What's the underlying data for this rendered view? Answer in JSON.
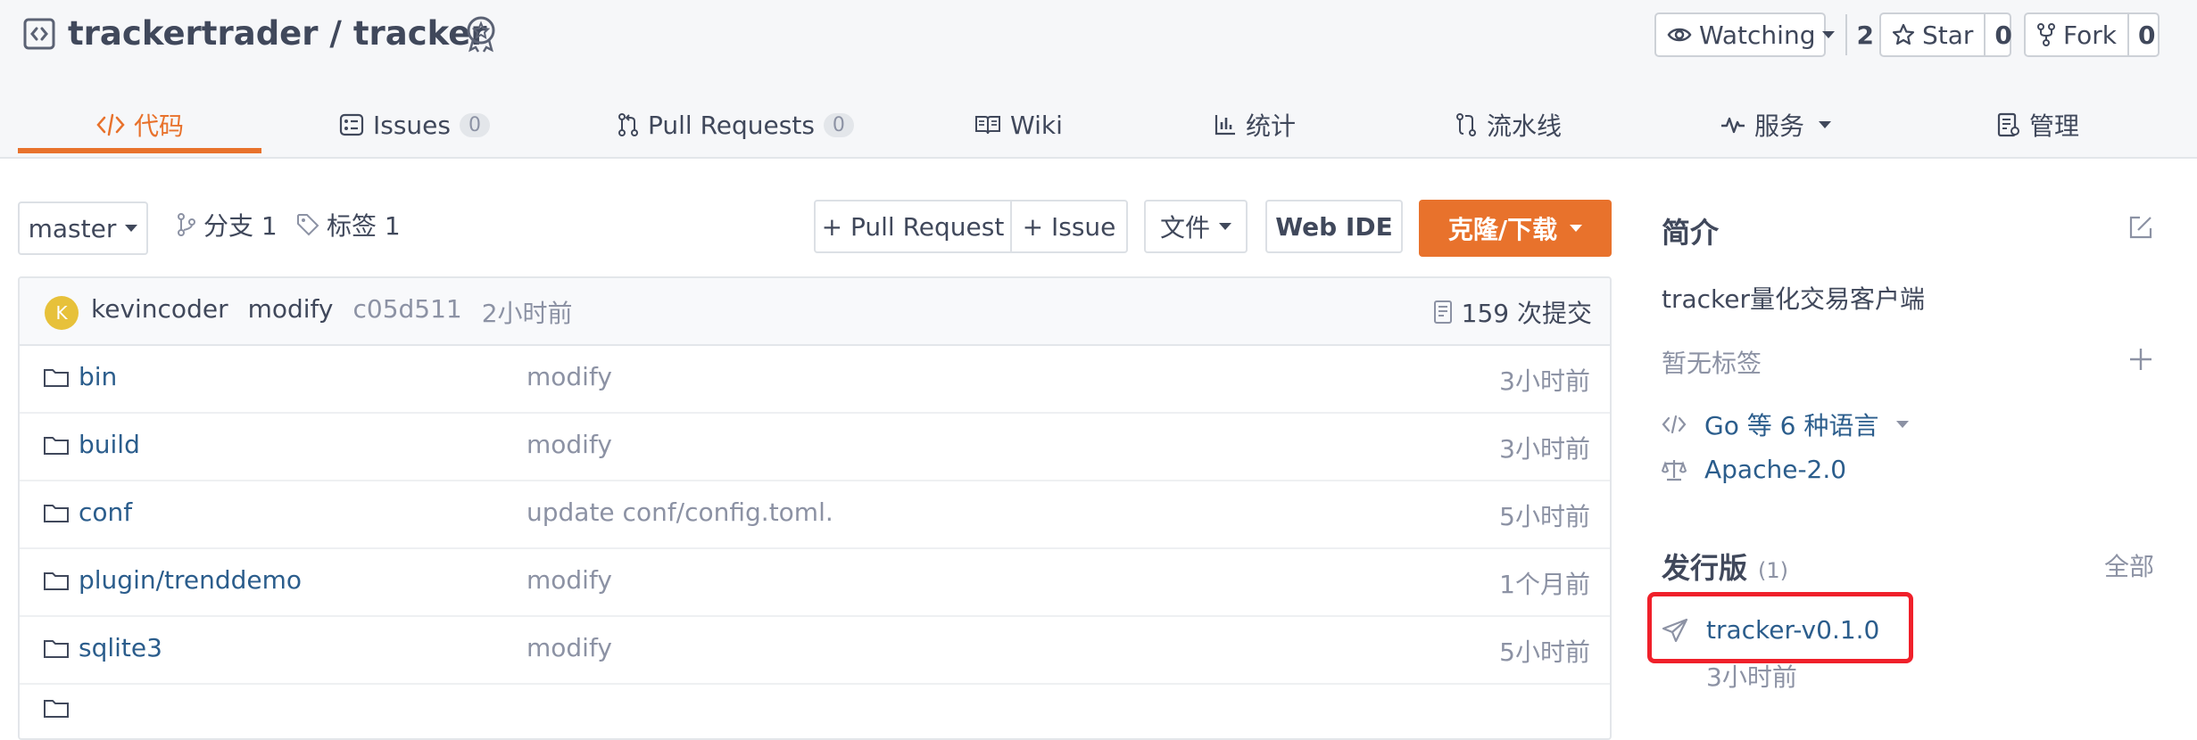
{
  "repo": {
    "owner": "trackertrader",
    "separator": " / ",
    "name": "tracker"
  },
  "header_buttons": {
    "watch": {
      "label": "Watching",
      "count": "2"
    },
    "star": {
      "label": "Star",
      "count": "0"
    },
    "fork": {
      "label": "Fork",
      "count": "0"
    }
  },
  "tabs": [
    {
      "label": "代码"
    },
    {
      "label": "Issues",
      "count": "0"
    },
    {
      "label": "Pull Requests",
      "count": "0"
    },
    {
      "label": "Wiki"
    },
    {
      "label": "统计"
    },
    {
      "label": "流水线"
    },
    {
      "label": "服务"
    },
    {
      "label": "管理"
    }
  ],
  "toolbar": {
    "branch": "master",
    "branches": "分支 1",
    "tags": "标签 1",
    "new_pr": "+ Pull Request",
    "new_issue": "+ Issue",
    "file": "文件",
    "web_ide": "Web IDE",
    "clone": "克隆/下载"
  },
  "commit": {
    "avatar_letter": "K",
    "author": "kevincoder",
    "message": "modify",
    "hash": "c05d511",
    "time": "2小时前",
    "count": "159 次提交"
  },
  "files": [
    {
      "name": "bin",
      "message": "modify",
      "time": "3小时前"
    },
    {
      "name": "build",
      "message": "modify",
      "time": "3小时前"
    },
    {
      "name": "conf",
      "message": "update conf/config.toml.",
      "time": "5小时前"
    },
    {
      "name_prefix": "plugin/",
      "name": "trenddemo",
      "message": "modify",
      "time": "1个月前"
    },
    {
      "name": "sqlite3",
      "message": "modify",
      "time": "5小时前"
    }
  ],
  "sidebar": {
    "intro_title": "简介",
    "description": "tracker量化交易客户端",
    "no_tags": "暂无标签",
    "languages": "Go 等 6 种语言",
    "license": "Apache-2.0",
    "releases_title": "发行版",
    "releases_count": "(1)",
    "all_link": "全部",
    "release_name": "tracker-v0.1.0",
    "release_time": "3小时前"
  },
  "colors": {
    "accent": "#e8722c",
    "link": "#2b5d8c",
    "highlight_box": "#f0202a"
  }
}
